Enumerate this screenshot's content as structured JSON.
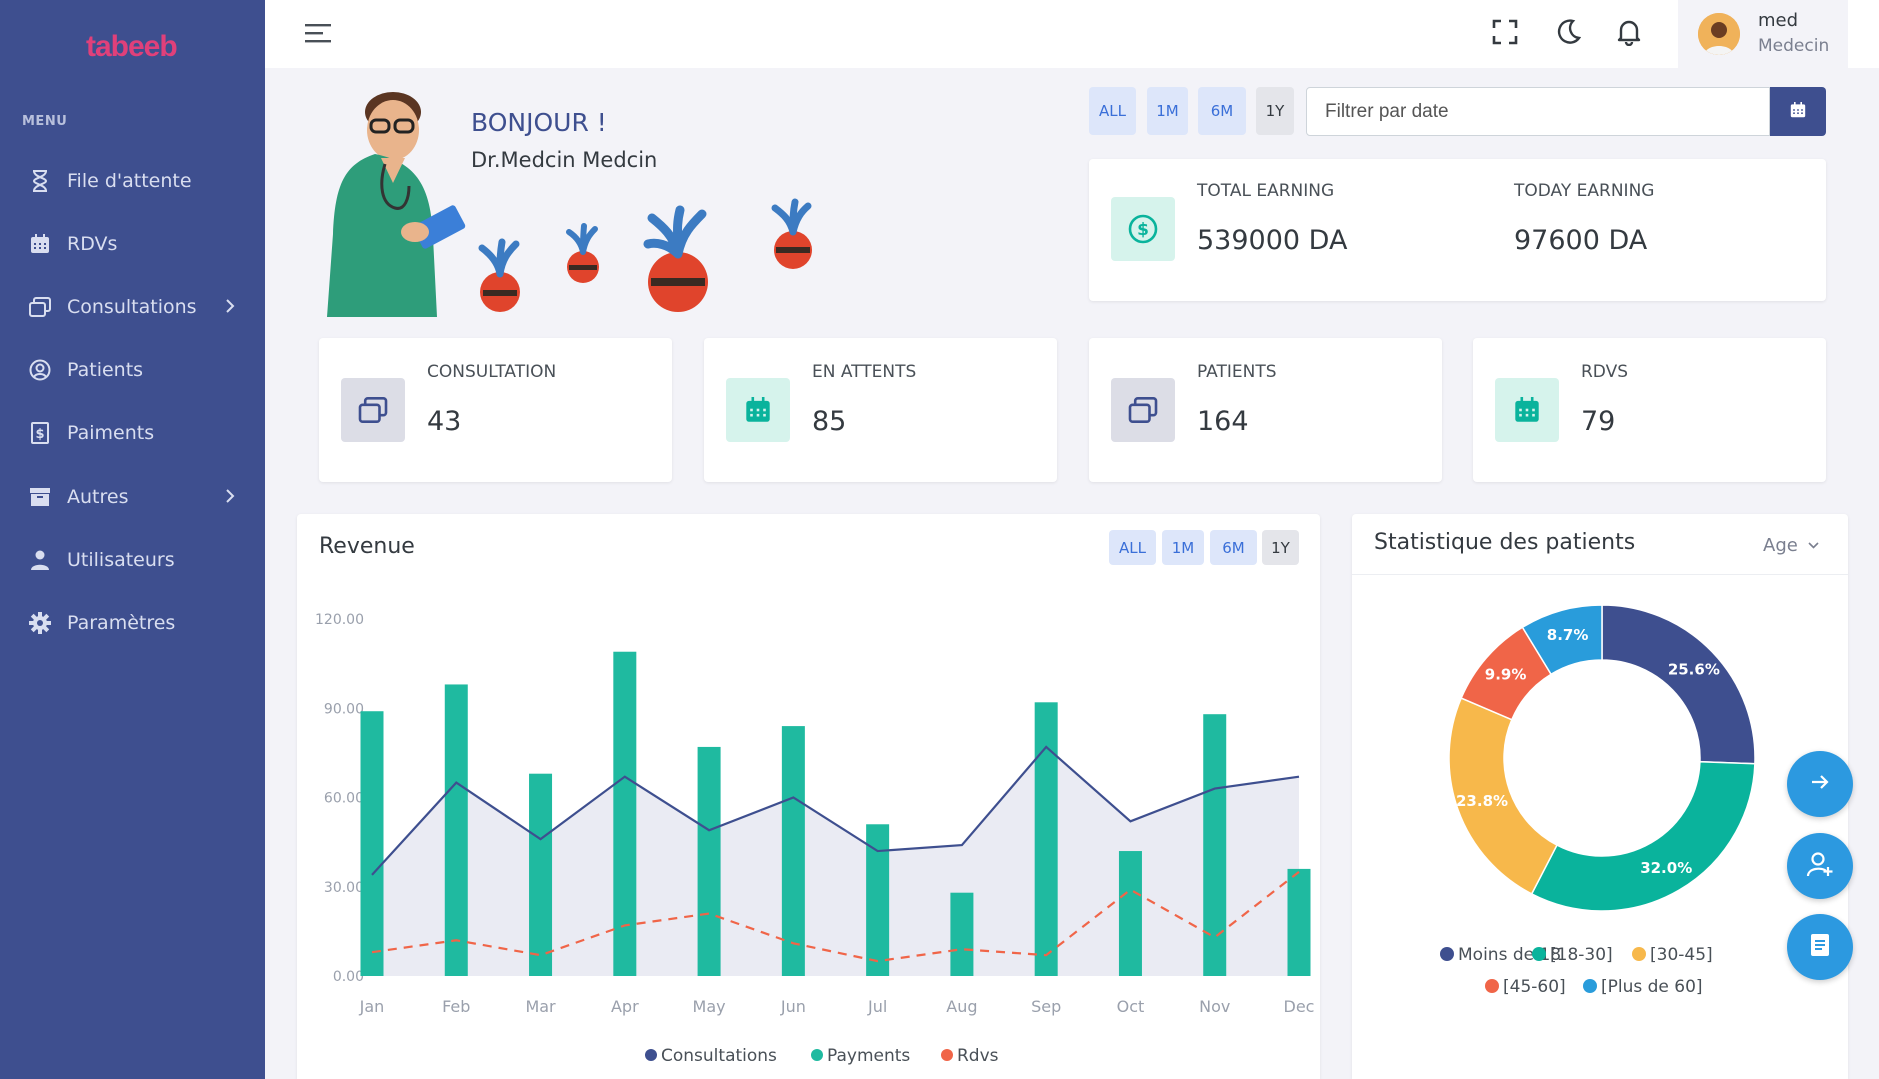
{
  "app": {
    "logo": "tabeeb"
  },
  "sidebar": {
    "menu_title": "MENU",
    "items": [
      {
        "label": "File d'attente",
        "icon": "hourglass-icon"
      },
      {
        "label": "RDVs",
        "icon": "calendar-icon"
      },
      {
        "label": "Consultations",
        "icon": "windows-icon",
        "has_submenu": true
      },
      {
        "label": "Patients",
        "icon": "user-circle-icon"
      },
      {
        "label": "Paiments",
        "icon": "dollar-receipt-icon"
      },
      {
        "label": "Autres",
        "icon": "archive-icon",
        "has_submenu": true
      },
      {
        "label": "Utilisateurs",
        "icon": "user-icon"
      },
      {
        "label": "Paramètres",
        "icon": "gear-icon"
      }
    ]
  },
  "topbar": {
    "user_name": "med",
    "user_role": "Medecin"
  },
  "welcome": {
    "greeting": "BONJOUR !",
    "doctor": "Dr.Medcin Medcin"
  },
  "filters": {
    "ranges": [
      "ALL",
      "1M",
      "6M",
      "1Y"
    ],
    "date_placeholder": "Filtrer par date"
  },
  "earnings": {
    "total_label": "TOTAL EARNING",
    "total_value": "539000 DA",
    "today_label": "TODAY EARNING",
    "today_value": "97600 DA"
  },
  "stats": [
    {
      "label": "CONSULTATION",
      "value": "43",
      "icon": "windows-icon"
    },
    {
      "label": "EN ATTENTS",
      "value": "85",
      "icon": "calendar-icon"
    },
    {
      "label": "PATIENTS",
      "value": "164",
      "icon": "windows-icon"
    },
    {
      "label": "RDVS",
      "value": "79",
      "icon": "calendar-icon"
    }
  ],
  "revenue": {
    "title": "Revenue",
    "ranges": [
      "ALL",
      "1M",
      "6M",
      "1Y"
    ]
  },
  "patients_stats": {
    "title": "Statistique des patients",
    "select": "Age"
  },
  "colors": {
    "sidebar": "#3e4f8f",
    "payments": "#1fbaa0",
    "consultations": "#3e4f8f",
    "rdvs": "#f06548",
    "fab": "#2c99e0"
  },
  "chart_data": [
    {
      "type": "bar",
      "title": "Revenue",
      "categories": [
        "Jan",
        "Feb",
        "Mar",
        "Apr",
        "May",
        "Jun",
        "Jul",
        "Aug",
        "Sep",
        "Oct",
        "Nov",
        "Dec"
      ],
      "y_ticks": [
        "0.00",
        "30.00",
        "60.00",
        "90.00",
        "120.00"
      ],
      "ylim": [
        0,
        120
      ],
      "series": [
        {
          "name": "Consultations",
          "kind": "area-line",
          "values": [
            34,
            65,
            46,
            67,
            49,
            60,
            42,
            44,
            77,
            52,
            63,
            67
          ]
        },
        {
          "name": "Payments",
          "kind": "bar",
          "values": [
            89,
            98,
            68,
            109,
            77,
            84,
            51,
            28,
            92,
            42,
            88,
            36
          ]
        },
        {
          "name": "Rdvs",
          "kind": "dashed-line",
          "values": [
            8,
            12,
            7,
            17,
            21,
            11,
            5,
            9,
            7,
            29,
            13,
            35
          ]
        }
      ],
      "legend": "bottom"
    },
    {
      "type": "pie",
      "title": "Statistique des patients",
      "labels": [
        "Moins de 18",
        "[18-30]",
        "[30-45]",
        "[45-60]",
        "[Plus de 60]"
      ],
      "values": [
        25.6,
        32.0,
        23.8,
        9.9,
        8.7
      ],
      "value_labels": [
        "25.6%",
        "32.0%",
        "23.8%",
        "9.9%",
        "8.7%"
      ],
      "colors": [
        "#3e4f8f",
        "#0ab39c",
        "#f7b84b",
        "#f06548",
        "#299cdb"
      ],
      "legend": "bottom"
    }
  ]
}
